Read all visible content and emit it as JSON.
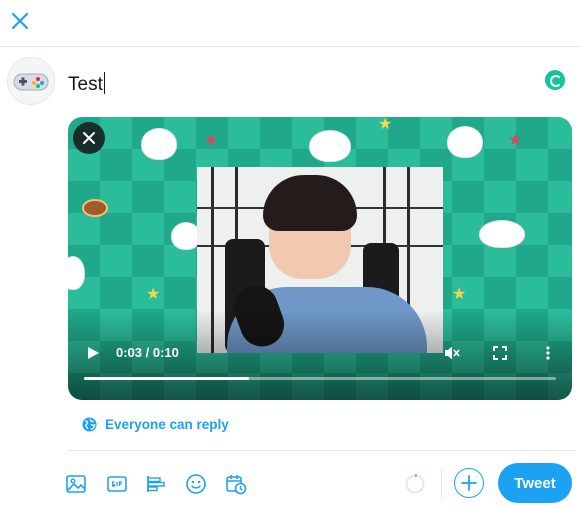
{
  "composer": {
    "text": "Test"
  },
  "media": {
    "video": {
      "time_label": "0:03 / 0:10",
      "progress_fraction": 0.35
    }
  },
  "reply_settings": {
    "label": "Everyone can reply"
  },
  "toolbar": {
    "tweet_label": "Tweet"
  },
  "colors": {
    "accent": "#1da1f2",
    "grammarly": "#15c39a",
    "media_background": "#1fa98a"
  },
  "icons": {
    "close": "close-icon",
    "grammarly": "grammarly-icon",
    "remove_media": "close-icon",
    "play": "play-icon",
    "mute": "volume-muted-icon",
    "fullscreen": "fullscreen-icon",
    "more": "more-vertical-icon",
    "globe": "globe-icon",
    "image": "image-icon",
    "gif": "gif-icon",
    "poll": "poll-icon",
    "emoji": "emoji-icon",
    "schedule": "schedule-icon",
    "add_thread": "plus-icon"
  }
}
